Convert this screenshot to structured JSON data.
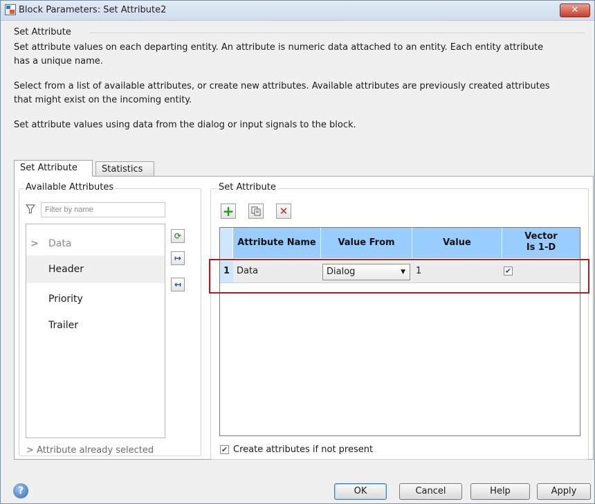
{
  "window": {
    "title": "Block Parameters: Set Attribute2"
  },
  "header": {
    "group_title": "Set Attribute",
    "desc1_line1": "Set attribute values on each departing entity. An attribute is numeric data attached to an entity. Each entity attribute",
    "desc1_line2": "has a unique name.",
    "desc2_line1": "Select from a list of available attributes, or create new attributes. Available attributes are previously created attributes",
    "desc2_line2": "that might exist on the incoming entity.",
    "desc3": "Set attribute values using data from the dialog or input signals to the block."
  },
  "tabs": [
    {
      "label": "Set Attribute",
      "active": true
    },
    {
      "label": "Statistics",
      "active": false
    }
  ],
  "available": {
    "title": "Available Attributes",
    "filter_placeholder": "Filter by name",
    "items": [
      {
        "label": "Data",
        "marker": ">",
        "dimmed": true
      },
      {
        "label": "Header",
        "selected": true
      },
      {
        "label": "Priority"
      },
      {
        "label": "Trailer"
      }
    ],
    "footer_note": "> Attribute already selected"
  },
  "set_attribute": {
    "title": "Set Attribute",
    "columns": [
      "Attribute Name",
      "Value From",
      "Value",
      "Vector",
      "Is 1-D"
    ],
    "rows": [
      {
        "num": "1",
        "name": "Data",
        "value_from": "Dialog",
        "value": "1",
        "vector_1d": true
      }
    ],
    "create_label": "Create attributes if not present",
    "create_checked": true
  },
  "buttons": {
    "ok": "OK",
    "cancel": "Cancel",
    "help": "Help",
    "apply": "Apply"
  },
  "colors": {
    "header_blue": "#99ccff",
    "highlight_red": "#b01d1d"
  }
}
